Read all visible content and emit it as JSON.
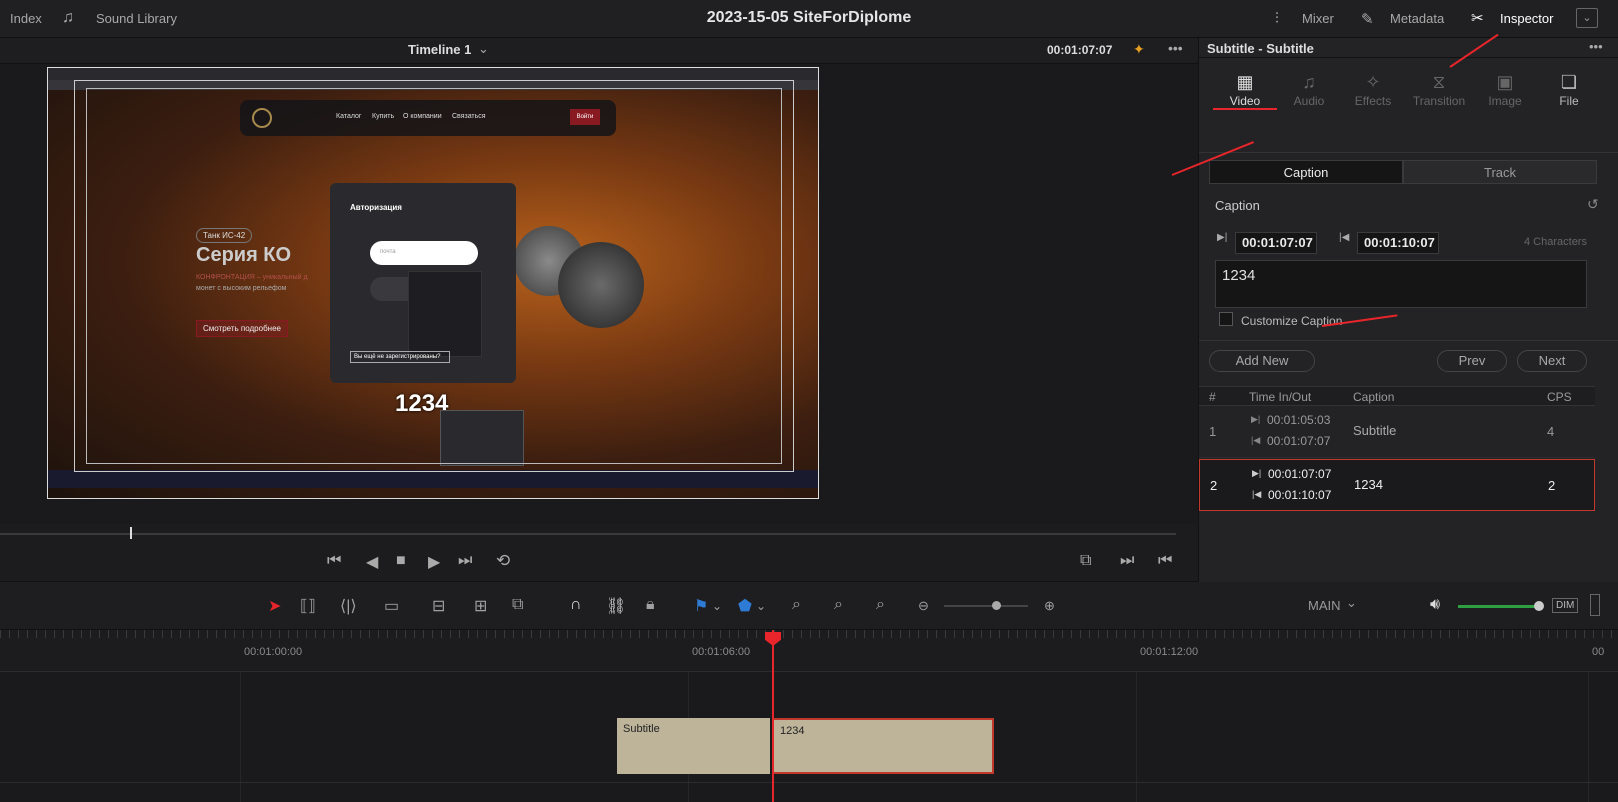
{
  "topbar": {
    "index": "Index",
    "sound_library": "Sound Library",
    "project_title": "2023-15-05 SiteForDiplome",
    "mixer": "Mixer",
    "metadata": "Metadata",
    "inspector": "Inspector"
  },
  "viewer": {
    "timeline_name": "Timeline 1",
    "timecode": "00:01:07:07",
    "subtitle_overlay": "1234",
    "site": {
      "nav": [
        "Каталог",
        "Купить",
        "О компании",
        "Связаться"
      ],
      "login_btn": "Войти",
      "badge": "Танк ИС-42",
      "heading": "Серия КО",
      "tagline": "КОНФРОНТАЦИЯ – уникальный д",
      "tagline2": "монет с высоким рельефом",
      "cta": "Смотреть подробнее",
      "auth_title": "Авторизация",
      "auth_placeholder": "почта",
      "register": "Вы ещё не зарегистрированы?"
    }
  },
  "inspector": {
    "title": "Subtitle - Subtitle",
    "tabs": [
      {
        "label": "Video",
        "icon": "film-icon",
        "glyph": "▦"
      },
      {
        "label": "Audio",
        "icon": "music-icon",
        "glyph": "♫"
      },
      {
        "label": "Effects",
        "icon": "wand-icon",
        "glyph": "✧"
      },
      {
        "label": "Transition",
        "icon": "transition-icon",
        "glyph": "⧖"
      },
      {
        "label": "Image",
        "icon": "image-icon",
        "glyph": "▣"
      },
      {
        "label": "File",
        "icon": "file-icon",
        "glyph": "❏"
      }
    ],
    "segment": {
      "caption": "Caption",
      "track": "Track"
    },
    "section_title": "Caption",
    "time_in": "00:01:07:07",
    "time_out": "00:01:10:07",
    "char_count": "4 Characters",
    "caption_text": "1234",
    "customize_label": "Customize Caption",
    "add_new": "Add New",
    "prev": "Prev",
    "next": "Next",
    "table": {
      "headers": [
        "#",
        "Time In/Out",
        "Caption",
        "CPS"
      ],
      "rows": [
        {
          "num": "1",
          "in": "00:01:05:03",
          "out": "00:01:07:07",
          "caption": "Subtitle",
          "cps": "4"
        },
        {
          "num": "2",
          "in": "00:01:07:07",
          "out": "00:01:10:07",
          "caption": "1234",
          "cps": "2"
        }
      ]
    }
  },
  "toolbar": {
    "main_label": "MAIN",
    "dim_label": "DIM"
  },
  "timeline": {
    "ruler": [
      "00:01:00:00",
      "00:01:06:00",
      "00:01:12:00"
    ],
    "clips": [
      {
        "label": "Subtitle"
      },
      {
        "label": "1234"
      }
    ]
  },
  "colors": {
    "accent": "#e8252a",
    "clip": "#bdb49a",
    "selected_border": "#c0392b"
  }
}
